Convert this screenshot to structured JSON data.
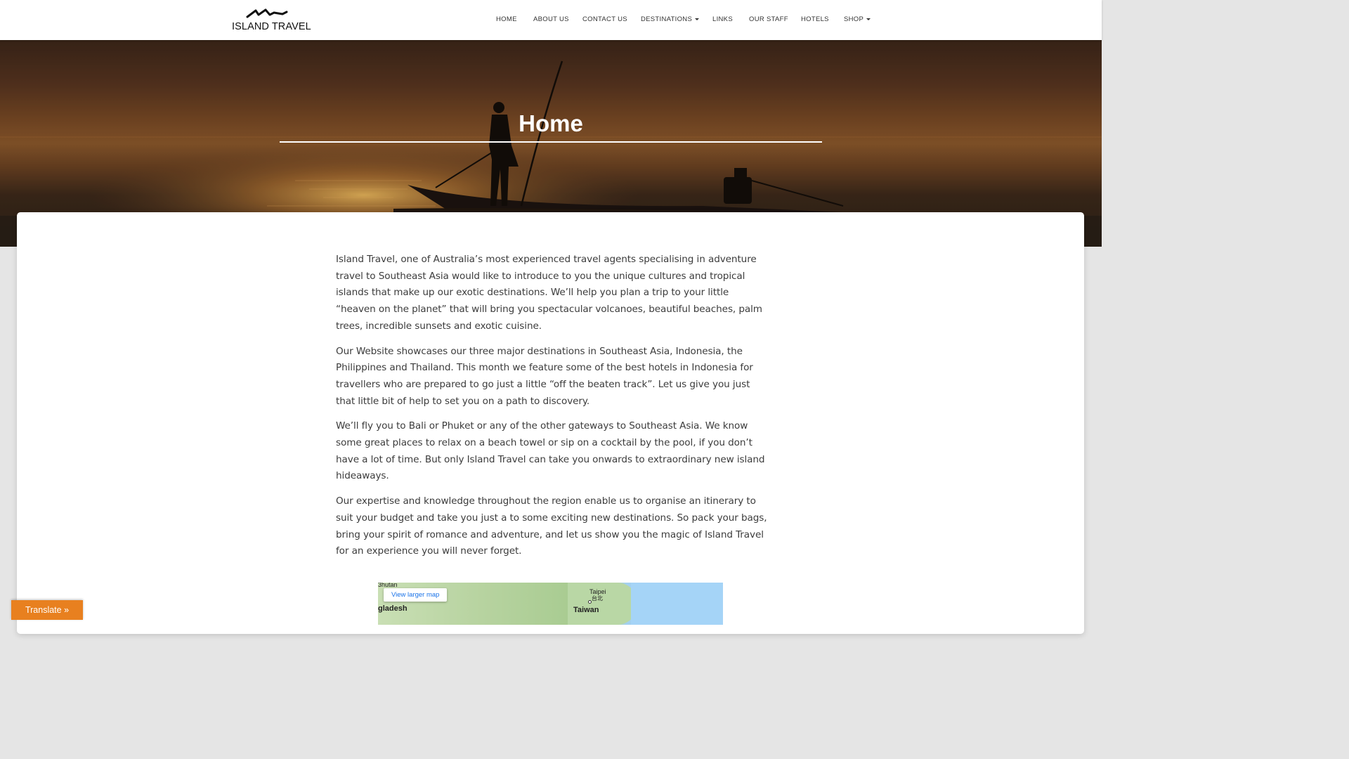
{
  "brand": {
    "logo_text": "ISLAND TRAVEL"
  },
  "nav": {
    "items": [
      {
        "label": "HOME",
        "dropdown": false
      },
      {
        "label": "ABOUT US",
        "dropdown": false
      },
      {
        "label": "CONTACT US",
        "dropdown": false
      },
      {
        "label": "DESTINATIONS",
        "dropdown": true
      },
      {
        "label": "LINKS",
        "dropdown": false
      },
      {
        "label": "OUR STAFF",
        "dropdown": false
      },
      {
        "label": "HOTELS",
        "dropdown": false
      },
      {
        "label": "SHOP",
        "dropdown": true
      }
    ]
  },
  "hero": {
    "title": "Home"
  },
  "content": {
    "paragraphs": [
      "Island Travel, one of Australia’s most experienced travel agents specialising in adventure travel to Southeast Asia would like to introduce to you the unique cultures and tropical islands that make up our exotic destinations. We’ll help you plan a trip to your little “heaven on the planet” that will bring you spectacular volcanoes, beautiful beaches, palm trees, incredible sunsets and exotic cuisine.",
      "Our Website showcases our three major destinations in Southeast Asia, Indonesia, the Philippines and Thailand. This month we feature some of the best hotels in Indonesia for travellers who are prepared to go just a little “off the beaten track”. Let us give you just that little bit of help to set you on a path to discovery.",
      "We’ll fly you to Bali or Phuket or any of the other gateways to Southeast Asia. We know some great places to relax on a beach towel or sip on a cocktail by the pool, if you don’t have a lot of time. But only Island Travel can take you onwards to extraordinary new island hideaways.",
      "Our expertise and knowledge throughout the region enable us to organise an itinerary to suit your budget and take you just a to some exciting new destinations. So pack your bags, bring your spirit of romance and adventure, and let us show you the magic of Island Travel for an experience you will never forget."
    ]
  },
  "map": {
    "button_label": "View larger map",
    "labels": {
      "bhutan": "3hutan",
      "bangladesh": "gladesh",
      "taipei": "Taipei",
      "taipei_local": "台北",
      "taiwan": "Taiwan"
    }
  },
  "translate": {
    "label": "Translate »"
  },
  "colors": {
    "accent": "#e8801f",
    "link": "#1a73e8",
    "hero_text": "#ffffff"
  }
}
